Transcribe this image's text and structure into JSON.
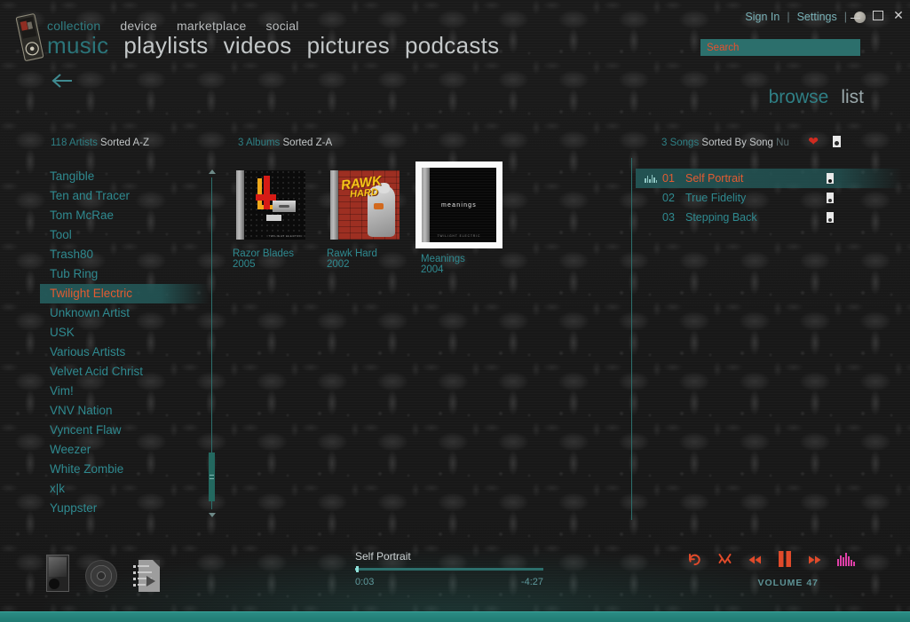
{
  "window": {
    "minimize_label": "minimize",
    "maximize_label": "maximize",
    "close_label": "close"
  },
  "account": {
    "sign_in": "Sign In",
    "separator": "|",
    "settings": "Settings"
  },
  "search": {
    "placeholder": "Search",
    "value": ""
  },
  "nav": {
    "tier1": [
      {
        "label": "collection",
        "active": true
      },
      {
        "label": "device",
        "active": false
      },
      {
        "label": "marketplace",
        "active": false
      },
      {
        "label": "social",
        "active": false
      }
    ],
    "tier2": [
      {
        "label": "music",
        "active": true
      },
      {
        "label": "playlists",
        "active": false
      },
      {
        "label": "videos",
        "active": false
      },
      {
        "label": "pictures",
        "active": false
      },
      {
        "label": "podcasts",
        "active": false
      }
    ]
  },
  "view_toggle": {
    "browse": "browse",
    "list": "list"
  },
  "columns": {
    "artists": {
      "count": "118 Artists",
      "sort": "Sorted A-Z"
    },
    "albums": {
      "count": "3 Albums",
      "sort": "Sorted Z-A"
    },
    "songs": {
      "count": "3 Songs",
      "sort": "Sorted By Song",
      "sort_dim": "Nu"
    }
  },
  "artists": [
    {
      "name": "Tangible",
      "selected": false
    },
    {
      "name": "Ten and Tracer",
      "selected": false
    },
    {
      "name": "Tom McRae",
      "selected": false
    },
    {
      "name": "Tool",
      "selected": false
    },
    {
      "name": "Trash80",
      "selected": false
    },
    {
      "name": "Tub Ring",
      "selected": false
    },
    {
      "name": "Twilight Electric",
      "selected": true
    },
    {
      "name": "Unknown Artist",
      "selected": false
    },
    {
      "name": "USK",
      "selected": false
    },
    {
      "name": "Various Artists",
      "selected": false
    },
    {
      "name": "Velvet Acid Christ",
      "selected": false
    },
    {
      "name": "Vim!",
      "selected": false
    },
    {
      "name": "VNV Nation",
      "selected": false
    },
    {
      "name": "Vyncent Flaw",
      "selected": false
    },
    {
      "name": "Weezer",
      "selected": false
    },
    {
      "name": "White Zombie",
      "selected": false
    },
    {
      "name": "x|k",
      "selected": false
    },
    {
      "name": "Yuppster",
      "selected": false
    }
  ],
  "albums": [
    {
      "title": "Razor Blades",
      "year": "2005",
      "selected": false,
      "art": "razor",
      "art_credit": "TWILIGHT ELECTRIC"
    },
    {
      "title": "Rawk Hard",
      "year": "2002",
      "selected": false,
      "art": "rawk",
      "art_text1": "RAWK",
      "art_text2": "HARD"
    },
    {
      "title": "Meanings",
      "year": "2004",
      "selected": true,
      "art": "meanings",
      "art_text1": "meanings",
      "art_text2": "TWILIGHT ELECTRIC"
    }
  ],
  "songs": [
    {
      "num": "01",
      "title": "Self Portrait",
      "playing": true
    },
    {
      "num": "02",
      "title": "True Fidelity",
      "playing": false
    },
    {
      "num": "03",
      "title": "Stepping Back",
      "playing": false
    }
  ],
  "player": {
    "now_playing_title": "Self Portrait",
    "elapsed": "0:03",
    "remaining": "-4:27",
    "progress_percent": 1,
    "volume_label": "VOLUME 47",
    "controls": {
      "repeat": "repeat-icon",
      "shuffle": "shuffle-icon",
      "previous": "previous-icon",
      "pause": "pause-icon",
      "next": "next-icon",
      "visualizer": "visualizer-icon"
    }
  },
  "colors": {
    "teal": "#2f8a90",
    "teal_dark": "#2c6f6c",
    "orange": "#e35b31",
    "accent_red": "#cf2b20",
    "magenta": "#e040a8",
    "text_light": "#cdd3d4"
  }
}
